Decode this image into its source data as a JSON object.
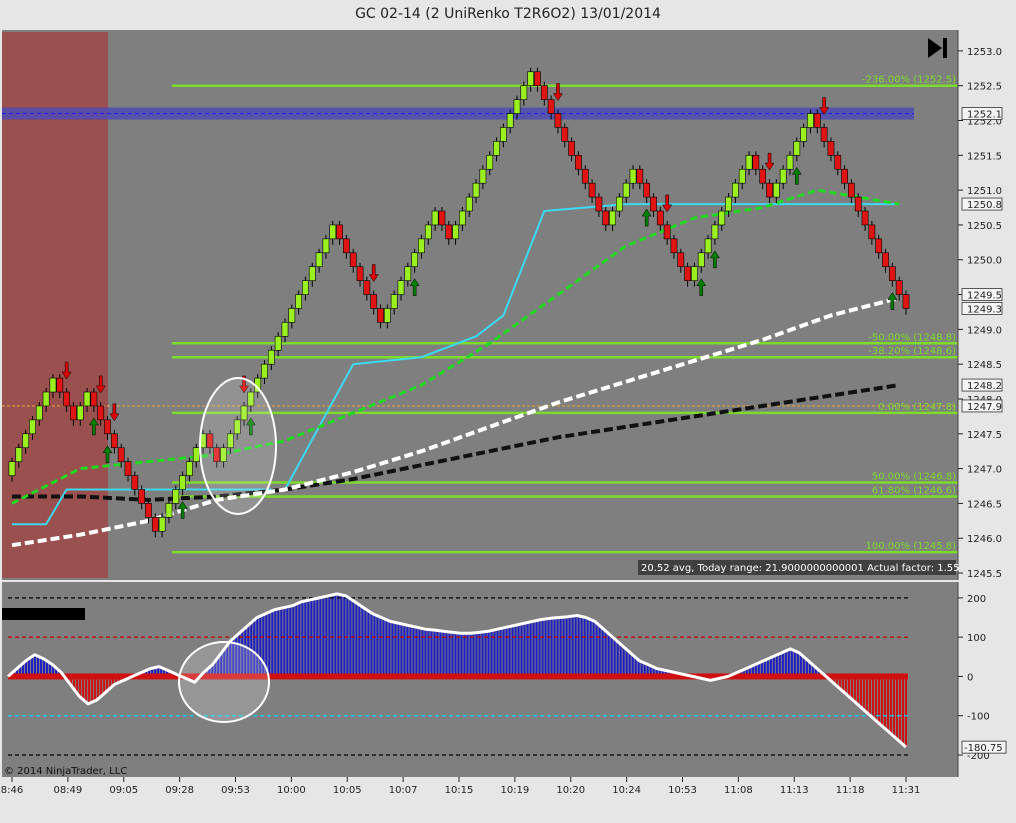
{
  "title": "GC 02-14 (2 UniRenko T2R6O2)  13/01/2014",
  "copyright": "© 2014 NinjaTrader, LLC",
  "info_text": "20.52 avg, Today range: 21.9000000000001  Actual factor: 1.55",
  "scroll_end_icon": "skip-to-end-icon",
  "colors": {
    "plot_bg": "#7f7f7f",
    "up_bar": "#99f01e",
    "down_bar": "#e11414",
    "fib_line": "#7ddc2b",
    "cyan_line": "#3dd9f0",
    "green_ma": "#22d922",
    "white_ma": "#ffffff",
    "black_ma": "#111111",
    "osc_pos": "#1e1ec8",
    "osc_neg": "#d01010",
    "shade_left": "#a04848",
    "blue_band": "#4a4ab8",
    "orange_line": "#e0a040"
  },
  "chart_data": [
    {
      "type": "renko",
      "title": "GC 02-14 (2 UniRenko T2R6O2)  13/01/2014",
      "ylim": [
        1245.4,
        1253.3
      ],
      "y_ticks": [
        "1253.0",
        "1252.5",
        "1252.0",
        "1251.5",
        "1251.0",
        "1250.5",
        "1250.0",
        "1249.5",
        "1249.0",
        "1248.5",
        "1248.0",
        "1247.5",
        "1247.0",
        "1246.5",
        "1246.0",
        "1245.5"
      ],
      "x_ticks": [
        "8:46",
        "08:49",
        "09:05",
        "09:28",
        "09:53",
        "10:00",
        "10:05",
        "10:07",
        "10:15",
        "10:19",
        "10:20",
        "10:24",
        "10:53",
        "11:08",
        "11:13",
        "11:18",
        "11:31"
      ],
      "brick_size": 0.2,
      "bricks": [
        {
          "open": 1246.9,
          "close": 1247.1
        },
        {
          "open": 1247.1,
          "close": 1247.3
        },
        {
          "open": 1247.3,
          "close": 1247.5
        },
        {
          "open": 1247.5,
          "close": 1247.7
        },
        {
          "open": 1247.7,
          "close": 1247.9
        },
        {
          "open": 1247.9,
          "close": 1248.1
        },
        {
          "open": 1248.1,
          "close": 1248.3
        },
        {
          "open": 1248.3,
          "close": 1248.1
        },
        {
          "open": 1248.1,
          "close": 1247.9
        },
        {
          "open": 1247.9,
          "close": 1247.7
        },
        {
          "open": 1247.7,
          "close": 1247.9
        },
        {
          "open": 1247.9,
          "close": 1248.1
        },
        {
          "open": 1248.1,
          "close": 1247.9
        },
        {
          "open": 1247.9,
          "close": 1247.7
        },
        {
          "open": 1247.7,
          "close": 1247.5
        },
        {
          "open": 1247.5,
          "close": 1247.3
        },
        {
          "open": 1247.3,
          "close": 1247.1
        },
        {
          "open": 1247.1,
          "close": 1246.9
        },
        {
          "open": 1246.9,
          "close": 1246.7
        },
        {
          "open": 1246.7,
          "close": 1246.5
        },
        {
          "open": 1246.5,
          "close": 1246.3
        },
        {
          "open": 1246.3,
          "close": 1246.1
        },
        {
          "open": 1246.1,
          "close": 1246.3
        },
        {
          "open": 1246.3,
          "close": 1246.5
        },
        {
          "open": 1246.5,
          "close": 1246.7
        },
        {
          "open": 1246.7,
          "close": 1246.9
        },
        {
          "open": 1246.9,
          "close": 1247.1
        },
        {
          "open": 1247.1,
          "close": 1247.3
        },
        {
          "open": 1247.3,
          "close": 1247.5
        },
        {
          "open": 1247.5,
          "close": 1247.3
        },
        {
          "open": 1247.3,
          "close": 1247.1
        },
        {
          "open": 1247.1,
          "close": 1247.3
        },
        {
          "open": 1247.3,
          "close": 1247.5
        },
        {
          "open": 1247.5,
          "close": 1247.7
        },
        {
          "open": 1247.7,
          "close": 1247.9
        },
        {
          "open": 1247.9,
          "close": 1248.1
        },
        {
          "open": 1248.1,
          "close": 1248.3
        },
        {
          "open": 1248.3,
          "close": 1248.5
        },
        {
          "open": 1248.5,
          "close": 1248.7
        },
        {
          "open": 1248.7,
          "close": 1248.9
        },
        {
          "open": 1248.9,
          "close": 1249.1
        },
        {
          "open": 1249.1,
          "close": 1249.3
        },
        {
          "open": 1249.3,
          "close": 1249.5
        },
        {
          "open": 1249.5,
          "close": 1249.7
        },
        {
          "open": 1249.7,
          "close": 1249.9
        },
        {
          "open": 1249.9,
          "close": 1250.1
        },
        {
          "open": 1250.1,
          "close": 1250.3
        },
        {
          "open": 1250.3,
          "close": 1250.5
        },
        {
          "open": 1250.5,
          "close": 1250.3
        },
        {
          "open": 1250.3,
          "close": 1250.1
        },
        {
          "open": 1250.1,
          "close": 1249.9
        },
        {
          "open": 1249.9,
          "close": 1249.7
        },
        {
          "open": 1249.7,
          "close": 1249.5
        },
        {
          "open": 1249.5,
          "close": 1249.3
        },
        {
          "open": 1249.3,
          "close": 1249.1
        },
        {
          "open": 1249.1,
          "close": 1249.3
        },
        {
          "open": 1249.3,
          "close": 1249.5
        },
        {
          "open": 1249.5,
          "close": 1249.7
        },
        {
          "open": 1249.7,
          "close": 1249.9
        },
        {
          "open": 1249.9,
          "close": 1250.1
        },
        {
          "open": 1250.1,
          "close": 1250.3
        },
        {
          "open": 1250.3,
          "close": 1250.5
        },
        {
          "open": 1250.5,
          "close": 1250.7
        },
        {
          "open": 1250.7,
          "close": 1250.5
        },
        {
          "open": 1250.5,
          "close": 1250.3
        },
        {
          "open": 1250.3,
          "close": 1250.5
        },
        {
          "open": 1250.5,
          "close": 1250.7
        },
        {
          "open": 1250.7,
          "close": 1250.9
        },
        {
          "open": 1250.9,
          "close": 1251.1
        },
        {
          "open": 1251.1,
          "close": 1251.3
        },
        {
          "open": 1251.3,
          "close": 1251.5
        },
        {
          "open": 1251.5,
          "close": 1251.7
        },
        {
          "open": 1251.7,
          "close": 1251.9
        },
        {
          "open": 1251.9,
          "close": 1252.1
        },
        {
          "open": 1252.1,
          "close": 1252.3
        },
        {
          "open": 1252.3,
          "close": 1252.5
        },
        {
          "open": 1252.5,
          "close": 1252.7
        },
        {
          "open": 1252.7,
          "close": 1252.5
        },
        {
          "open": 1252.5,
          "close": 1252.3
        },
        {
          "open": 1252.3,
          "close": 1252.1
        },
        {
          "open": 1252.1,
          "close": 1251.9
        },
        {
          "open": 1251.9,
          "close": 1251.7
        },
        {
          "open": 1251.7,
          "close": 1251.5
        },
        {
          "open": 1251.5,
          "close": 1251.3
        },
        {
          "open": 1251.3,
          "close": 1251.1
        },
        {
          "open": 1251.1,
          "close": 1250.9
        },
        {
          "open": 1250.9,
          "close": 1250.7
        },
        {
          "open": 1250.7,
          "close": 1250.5
        },
        {
          "open": 1250.5,
          "close": 1250.7
        },
        {
          "open": 1250.7,
          "close": 1250.9
        },
        {
          "open": 1250.9,
          "close": 1251.1
        },
        {
          "open": 1251.1,
          "close": 1251.3
        },
        {
          "open": 1251.3,
          "close": 1251.1
        },
        {
          "open": 1251.1,
          "close": 1250.9
        },
        {
          "open": 1250.9,
          "close": 1250.7
        },
        {
          "open": 1250.7,
          "close": 1250.5
        },
        {
          "open": 1250.5,
          "close": 1250.3
        },
        {
          "open": 1250.3,
          "close": 1250.1
        },
        {
          "open": 1250.1,
          "close": 1249.9
        },
        {
          "open": 1249.9,
          "close": 1249.7
        },
        {
          "open": 1249.7,
          "close": 1249.9
        },
        {
          "open": 1249.9,
          "close": 1250.1
        },
        {
          "open": 1250.1,
          "close": 1250.3
        },
        {
          "open": 1250.3,
          "close": 1250.5
        },
        {
          "open": 1250.5,
          "close": 1250.7
        },
        {
          "open": 1250.7,
          "close": 1250.9
        },
        {
          "open": 1250.9,
          "close": 1251.1
        },
        {
          "open": 1251.1,
          "close": 1251.3
        },
        {
          "open": 1251.3,
          "close": 1251.5
        },
        {
          "open": 1251.5,
          "close": 1251.3
        },
        {
          "open": 1251.3,
          "close": 1251.1
        },
        {
          "open": 1251.1,
          "close": 1250.9
        },
        {
          "open": 1250.9,
          "close": 1251.1
        },
        {
          "open": 1251.1,
          "close": 1251.3
        },
        {
          "open": 1251.3,
          "close": 1251.5
        },
        {
          "open": 1251.5,
          "close": 1251.7
        },
        {
          "open": 1251.7,
          "close": 1251.9
        },
        {
          "open": 1251.9,
          "close": 1252.1
        },
        {
          "open": 1252.1,
          "close": 1251.9
        },
        {
          "open": 1251.9,
          "close": 1251.7
        },
        {
          "open": 1251.7,
          "close": 1251.5
        },
        {
          "open": 1251.5,
          "close": 1251.3
        },
        {
          "open": 1251.3,
          "close": 1251.1
        },
        {
          "open": 1251.1,
          "close": 1250.9
        },
        {
          "open": 1250.9,
          "close": 1250.7
        },
        {
          "open": 1250.7,
          "close": 1250.5
        },
        {
          "open": 1250.5,
          "close": 1250.3
        },
        {
          "open": 1250.3,
          "close": 1250.1
        },
        {
          "open": 1250.1,
          "close": 1249.9
        },
        {
          "open": 1249.9,
          "close": 1249.7
        },
        {
          "open": 1249.7,
          "close": 1249.5
        },
        {
          "open": 1249.5,
          "close": 1249.3
        }
      ],
      "fib_levels": [
        {
          "label": "-236.00% (1252.5)",
          "price": 1252.5
        },
        {
          "label": "-50.00% (1248.8)",
          "price": 1248.8
        },
        {
          "label": "-38.20% (1248.6)",
          "price": 1248.6
        },
        {
          "label": "0.00% (1247.8)",
          "price": 1247.8
        },
        {
          "label": "50.00% (1246.8)",
          "price": 1246.8
        },
        {
          "label": "61.80% (1246.6)",
          "price": 1246.6
        },
        {
          "label": "100.00% (1245.8)",
          "price": 1245.8
        }
      ],
      "price_markers": [
        {
          "label": "1252.1",
          "price": 1252.1
        },
        {
          "label": "1250.8",
          "price": 1250.8
        },
        {
          "label": "1249.5",
          "price": 1249.5
        },
        {
          "label": "1249.3",
          "price": 1249.3
        },
        {
          "label": "1248.2",
          "price": 1248.2
        },
        {
          "label": "1247.9",
          "price": 1247.9
        }
      ],
      "blue_band_price": 1252.1,
      "orange_line_price": 1247.9,
      "cyan_line": [
        [
          0,
          1246.2
        ],
        [
          5,
          1246.2
        ],
        [
          8,
          1246.7
        ],
        [
          20,
          1246.7
        ],
        [
          28,
          1246.7
        ],
        [
          40,
          1246.7
        ],
        [
          45,
          1247.6
        ],
        [
          50,
          1248.5
        ],
        [
          60,
          1248.6
        ],
        [
          68,
          1248.9
        ],
        [
          72,
          1249.2
        ],
        [
          78,
          1250.7
        ],
        [
          90,
          1250.8
        ],
        [
          130,
          1250.8
        ]
      ],
      "green_ma": [
        [
          0,
          1246.5
        ],
        [
          10,
          1247.0
        ],
        [
          20,
          1247.1
        ],
        [
          30,
          1247.2
        ],
        [
          40,
          1247.4
        ],
        [
          50,
          1247.8
        ],
        [
          60,
          1248.2
        ],
        [
          70,
          1248.8
        ],
        [
          80,
          1249.5
        ],
        [
          90,
          1250.2
        ],
        [
          100,
          1250.6
        ],
        [
          110,
          1250.75
        ],
        [
          118,
          1251.0
        ],
        [
          124,
          1250.9
        ],
        [
          130,
          1250.8
        ]
      ],
      "white_ma": [
        [
          0,
          1245.9
        ],
        [
          10,
          1246.05
        ],
        [
          20,
          1246.25
        ],
        [
          30,
          1246.55
        ],
        [
          40,
          1246.7
        ],
        [
          50,
          1246.95
        ],
        [
          60,
          1247.25
        ],
        [
          70,
          1247.6
        ],
        [
          80,
          1247.95
        ],
        [
          90,
          1248.25
        ],
        [
          100,
          1248.55
        ],
        [
          110,
          1248.85
        ],
        [
          120,
          1249.2
        ],
        [
          130,
          1249.45
        ]
      ],
      "black_ma": [
        [
          0,
          1246.6
        ],
        [
          10,
          1246.6
        ],
        [
          20,
          1246.55
        ],
        [
          30,
          1246.6
        ],
        [
          40,
          1246.7
        ],
        [
          50,
          1246.85
        ],
        [
          60,
          1247.05
        ],
        [
          70,
          1247.25
        ],
        [
          80,
          1247.45
        ],
        [
          90,
          1247.6
        ],
        [
          100,
          1247.75
        ],
        [
          110,
          1247.9
        ],
        [
          120,
          1248.05
        ],
        [
          130,
          1248.2
        ]
      ],
      "signals": [
        {
          "i": 8,
          "dir": "down"
        },
        {
          "i": 13,
          "dir": "down"
        },
        {
          "i": 15,
          "dir": "down"
        },
        {
          "i": 12,
          "dir": "up"
        },
        {
          "i": 14,
          "dir": "up"
        },
        {
          "i": 25,
          "dir": "up"
        },
        {
          "i": 34,
          "dir": "down"
        },
        {
          "i": 35,
          "dir": "up"
        },
        {
          "i": 53,
          "dir": "down"
        },
        {
          "i": 59,
          "dir": "up"
        },
        {
          "i": 80,
          "dir": "down"
        },
        {
          "i": 96,
          "dir": "down"
        },
        {
          "i": 93,
          "dir": "up"
        },
        {
          "i": 101,
          "dir": "up"
        },
        {
          "i": 103,
          "dir": "up"
        },
        {
          "i": 111,
          "dir": "down"
        },
        {
          "i": 115,
          "dir": "up"
        },
        {
          "i": 119,
          "dir": "down"
        },
        {
          "i": 129,
          "dir": "up"
        }
      ]
    },
    {
      "type": "bar",
      "title": "",
      "ylim": [
        -200,
        220
      ],
      "y_ticks": [
        "200",
        "100",
        "0",
        "-100",
        "-200"
      ],
      "last_value_label": "-180.75",
      "reference_lines": [
        200,
        100,
        0,
        -100,
        -200
      ],
      "values": [
        0,
        20,
        40,
        55,
        45,
        30,
        10,
        -20,
        -50,
        -70,
        -60,
        -40,
        -20,
        -10,
        0,
        10,
        20,
        25,
        15,
        5,
        -5,
        -15,
        10,
        30,
        60,
        90,
        110,
        130,
        150,
        160,
        170,
        175,
        180,
        190,
        195,
        200,
        205,
        210,
        205,
        190,
        175,
        160,
        150,
        140,
        135,
        130,
        125,
        120,
        118,
        115,
        112,
        110,
        110,
        112,
        115,
        120,
        125,
        130,
        135,
        140,
        145,
        148,
        150,
        152,
        155,
        150,
        140,
        120,
        100,
        80,
        60,
        40,
        30,
        20,
        15,
        10,
        5,
        0,
        -5,
        -10,
        -5,
        0,
        10,
        20,
        30,
        40,
        50,
        60,
        70,
        60,
        40,
        20,
        0,
        -20,
        -40,
        -60,
        -80,
        -100,
        -120,
        -140,
        -160,
        -180
      ]
    }
  ]
}
